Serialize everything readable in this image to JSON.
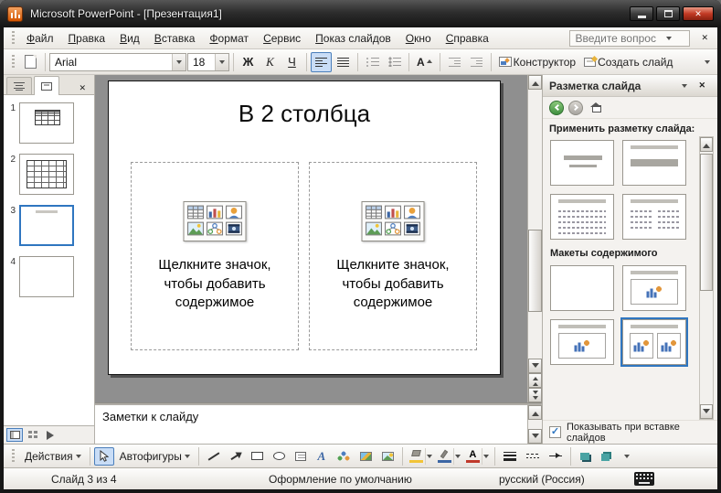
{
  "colors": {
    "selection_blue": "#2f76c0",
    "powerpoint_orange": "#d35400",
    "close_button_red": "#c23a24",
    "slide_canvas_gray": "#8f8f8f"
  },
  "glyphs": {
    "close_x": "✕",
    "check": "✓"
  },
  "window": {
    "title": "Microsoft PowerPoint - [Презентация1]"
  },
  "menubar": {
    "items": [
      "Файл",
      "Правка",
      "Вид",
      "Вставка",
      "Формат",
      "Сервис",
      "Показ слайдов",
      "Окно",
      "Справка"
    ],
    "question_box": "Введите вопрос"
  },
  "format_toolbar": {
    "font_name": "Arial",
    "font_size": "18",
    "bold": "Ж",
    "italic": "К",
    "underline": "Ч",
    "grow_font": "А",
    "designer": "Конструктор",
    "new_slide": "Создать слайд"
  },
  "slides_panel": {
    "numbers": [
      "1",
      "2",
      "3",
      "4"
    ],
    "selected": "3"
  },
  "slide": {
    "title": "В 2 столбца",
    "placeholder_lines": [
      "Щелкните значок,",
      "чтобы добавить",
      "содержимое"
    ]
  },
  "notes": {
    "placeholder": "Заметки к слайду"
  },
  "task_pane": {
    "title": "Разметка слайда",
    "apply_label": "Применить разметку слайда:",
    "content_section": "Макеты содержимого",
    "show_on_insert": "Показывать при вставке слайдов"
  },
  "drawing_toolbar": {
    "actions": "Действия",
    "autoshapes": "Автофигуры",
    "wordart_letter": "A",
    "font_color_letter": "А"
  },
  "status_bar": {
    "slide_info": "Слайд 3 из 4",
    "design": "Оформление по умолчанию",
    "language": "русский (Россия)"
  }
}
